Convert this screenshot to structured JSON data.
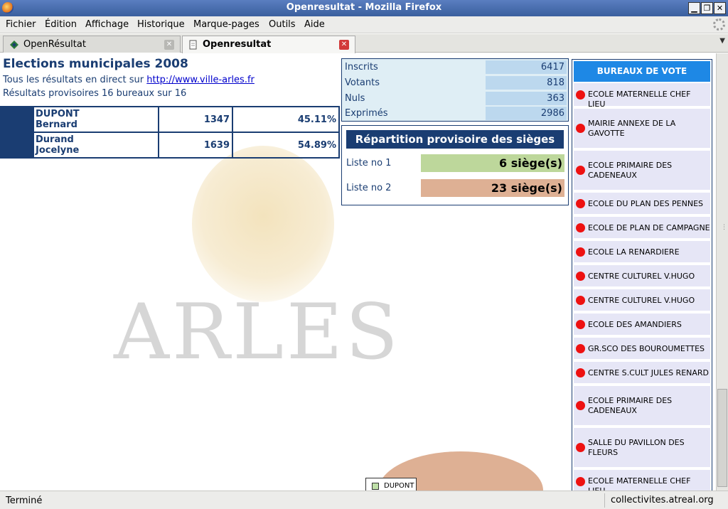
{
  "window": {
    "title": "Openresultat - Mozilla Firefox"
  },
  "menu": {
    "items": [
      {
        "label": "Fichier"
      },
      {
        "label": "Édition"
      },
      {
        "label": "Affichage"
      },
      {
        "label": "Historique"
      },
      {
        "label": "Marque-pages"
      },
      {
        "label": "Outils"
      },
      {
        "label": "Aide"
      }
    ]
  },
  "tabs": [
    {
      "label": "OpenRésultat"
    },
    {
      "label": "Openresultat"
    }
  ],
  "page": {
    "title": "Elections municipales 2008",
    "live_prefix": "Tous les résultats en direct sur ",
    "live_link": "http://www.ville-arles.fr",
    "provisional": "Résultats provisoires 16 bureaux sur 16",
    "watermark": "ARLES"
  },
  "candidates": [
    {
      "last": "DUPONT",
      "first": "Bernard",
      "votes": "1347",
      "percent": "45.11%"
    },
    {
      "last": "Durand",
      "first": "Jocelyne",
      "votes": "1639",
      "percent": "54.89%"
    }
  ],
  "stats": {
    "rows": [
      {
        "label": "Inscrits",
        "value": "6417"
      },
      {
        "label": "Votants",
        "value": "818"
      },
      {
        "label": "Nuls",
        "value": "363"
      },
      {
        "label": "Exprimés",
        "value": "2986"
      }
    ]
  },
  "seats": {
    "title": "Répartition provisoire des sièges",
    "rows": [
      {
        "label": "Liste no 1",
        "value": "6 siège(s)",
        "color": "#bdd79b"
      },
      {
        "label": "Liste no 2",
        "value": "23 siège(s)",
        "color": "#deb094"
      }
    ]
  },
  "chart": {
    "legend": "DUPONT"
  },
  "bureaux": {
    "title": "BUREAUX DE VOTE",
    "items": [
      "ECOLE MATERNELLE CHEF LIEU",
      "MAIRIE ANNEXE DE LA GAVOTTE",
      "ECOLE PRIMAIRE DES CADENEAUX",
      "ECOLE DU PLAN DES PENNES",
      "ECOLE DE PLAN DE CAMPAGNE",
      "ECOLE LA RENARDIERE",
      "CENTRE CULTUREL V.HUGO",
      "CENTRE CULTUREL V.HUGO",
      "ECOLE DES AMANDIERS",
      "GR.SCO DES BOUROUMETTES",
      "CENTRE S.CULT JULES RENARD",
      "ECOLE PRIMAIRE DES CADENEAUX",
      "SALLE DU PAVILLON DES FLEURS",
      "ECOLE MATERNELLE CHEF LIEU"
    ]
  },
  "status": {
    "text": "Terminé",
    "domain": "collectivites.atreal.org"
  }
}
